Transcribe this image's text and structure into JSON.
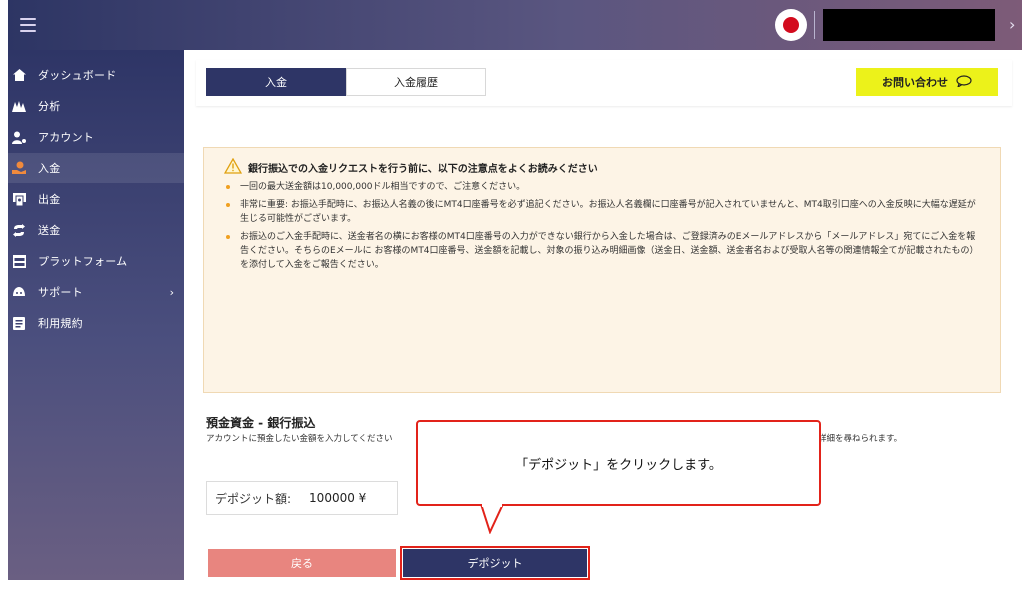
{
  "sidebar": {
    "items": [
      {
        "label": "ダッシュボード",
        "icon": "home-icon"
      },
      {
        "label": "分析",
        "icon": "analytics-icon"
      },
      {
        "label": "アカウント",
        "icon": "account-icon"
      },
      {
        "label": "入金",
        "icon": "deposit-icon"
      },
      {
        "label": "出金",
        "icon": "withdraw-icon"
      },
      {
        "label": "送金",
        "icon": "transfer-icon"
      },
      {
        "label": "プラットフォーム",
        "icon": "platform-icon"
      },
      {
        "label": "サポート",
        "icon": "support-icon"
      },
      {
        "label": "利用規約",
        "icon": "terms-icon"
      }
    ],
    "active_index": 3
  },
  "tabs": {
    "deposit": "入金",
    "history": "入金履歴"
  },
  "contact": {
    "label": "お問い合わせ",
    "icon": "chat-bubble-icon"
  },
  "notice": {
    "title": "銀行振込での入金リクエストを行う前に、以下の注意点をよくお読みください",
    "items": [
      "一回の最大送金額は10,000,000ドル相当ですので、ご注意ください。",
      "非常に重要: お振込手配時に、お振込人名義の後にMT4口座番号を必ず追記ください。お振込人名義欄に口座番号が記入されていませんと、MT4取引口座への入金反映に大幅な遅延が生じる可能性がございます。",
      "お振込のご入金手配時に、送金者名の横にお客様のMT4口座番号の入力ができない銀行から入金した場合は、ご登録済みのEメールアドレスから「メールアドレス」宛てにご入金を報告ください。そちらのEメールに お客様のMT4口座番号、送金額を記載し、対象の振り込み明細画像（送金日、送金額、送金者名および受取人名等の関連情報全てが記載されたもの）を添付して入金をご報告ください。"
    ]
  },
  "form": {
    "title": "預金資金 - 銀行振込",
    "description": "アカウントに預金したい金額を入力してください",
    "description_tail": "詳細を尋ねられます。",
    "amount_label": "デポジット額:",
    "amount_value": "100000 ¥",
    "back_label": "戻る",
    "deposit_label": "デポジット"
  },
  "callout": {
    "text": "「デポジット」をクリックします。"
  },
  "colors": {
    "navy": "#2e3566",
    "accent_yellow": "#ecf21a",
    "back_button": "#e8857f",
    "highlight_red": "#e2231a",
    "notice_bg": "#fdf4e6"
  }
}
